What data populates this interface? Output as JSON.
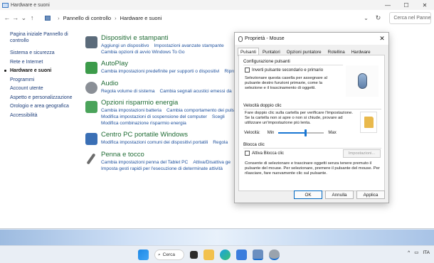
{
  "window": {
    "title": "Hardware e suoni",
    "controls": [
      "—",
      "☐",
      "✕"
    ]
  },
  "addressbar": {
    "back": "←",
    "forward": "→",
    "recent": "⌄",
    "up": "↑",
    "crumbs": [
      "Pannello di controllo",
      "Hardware e suoni"
    ],
    "separator": "›",
    "dropdown": "⌄",
    "refresh": "↻",
    "search_placeholder": "Cerca nel Pannello di controllo"
  },
  "leftnav": {
    "items": [
      "Pagina iniziale Pannello di controllo",
      "Sistema e sicurezza",
      "Rete e Internet",
      "Hardware e suoni",
      "Programmi",
      "Account utente",
      "Aspetto e personalizzazione",
      "Orologio e area geografica",
      "Accessibilità"
    ],
    "current_index": 3
  },
  "categories": [
    {
      "title": "Dispositivi e stampanti",
      "icon": "printer-icon",
      "color": "#5b6b7a",
      "lines": [
        [
          "Aggiungi un dispositivo",
          "Impostazioni avanzate stampante"
        ],
        [
          "Cambia opzioni di avvio Windows To Go"
        ]
      ]
    },
    {
      "title": "AutoPlay",
      "icon": "autoplay-icon",
      "color": "#3c9b4a",
      "lines": [
        [
          "Cambia impostazioni predefinite per supporti o dispositivi",
          "Riproduci"
        ]
      ]
    },
    {
      "title": "Audio",
      "icon": "speaker-icon",
      "color": "#8a8f96",
      "lines": [
        [
          "Regola volume di sistema",
          "Cambia segnali acustici emessi da"
        ]
      ]
    },
    {
      "title": "Opzioni risparmio energia",
      "icon": "power-options-icon",
      "color": "#4aa35a",
      "lines": [
        [
          "Cambia impostazioni batteria",
          "Cambia comportamento dei pulsanti"
        ],
        [
          "Modifica impostazioni di sospensione del computer",
          "Scegli"
        ],
        [
          "Modifica combinazione risparmio energia"
        ]
      ]
    },
    {
      "title": "Centro PC portatile Windows",
      "icon": "mobility-center-icon",
      "color": "#3a6fb5",
      "lines": [
        [
          "Modifica impostazioni comuni dei dispositivi portatili",
          "Regola"
        ]
      ]
    },
    {
      "title": "Penna e tocco",
      "icon": "pen-icon",
      "color": "#6c6c6c",
      "lines": [
        [
          "Cambia impostazioni penna del Tablet PC",
          "Attiva/Disattiva ge"
        ],
        [
          "Imposta gesti rapidi per l'esecuzione di determinate attività"
        ]
      ]
    }
  ],
  "dialog": {
    "title": "Proprietà - Mouse",
    "close": "✕",
    "tabs": [
      "Pulsanti",
      "Puntatori",
      "Opzioni puntatore",
      "Rotellina",
      "Hardware"
    ],
    "active_tab": 0,
    "group1": {
      "label": "Configurazione pulsanti",
      "checkbox": "Inverti pulsante secondario e primario",
      "checked": false,
      "desc": "Selezionare questa casella per assegnare al pulsante destro funzioni primarie, come la selezione e il trascinamento di oggetti."
    },
    "group2": {
      "label": "Velocità doppio clic",
      "desc": "Fare doppio clic sulla cartella per verificare l'impostazione. Se la cartella non si apre o non si chiude, provare ad utilizzare un'impostazione più lenta.",
      "speed_label": "Velocità:",
      "min": "Min",
      "max": "Max",
      "speed_fraction": 0.6
    },
    "group3": {
      "label": "Blocca clic",
      "checkbox": "Attiva Blocca clic",
      "checked": false,
      "settings_button": "Impostazioni...",
      "desc": "Consente di selezionare e trascinare oggetti senza tenere premuto il pulsante del mouse. Per selezionare, premere il pulsante del mouse. Per rilasciare, fare nuovamente clic sul pulsante."
    },
    "buttons": {
      "ok": "OK",
      "cancel": "Annulla",
      "apply": "Applica"
    }
  },
  "taskbar": {
    "search_label": "Cerca",
    "tray": {
      "chevron": "^",
      "language": "ITA"
    }
  }
}
